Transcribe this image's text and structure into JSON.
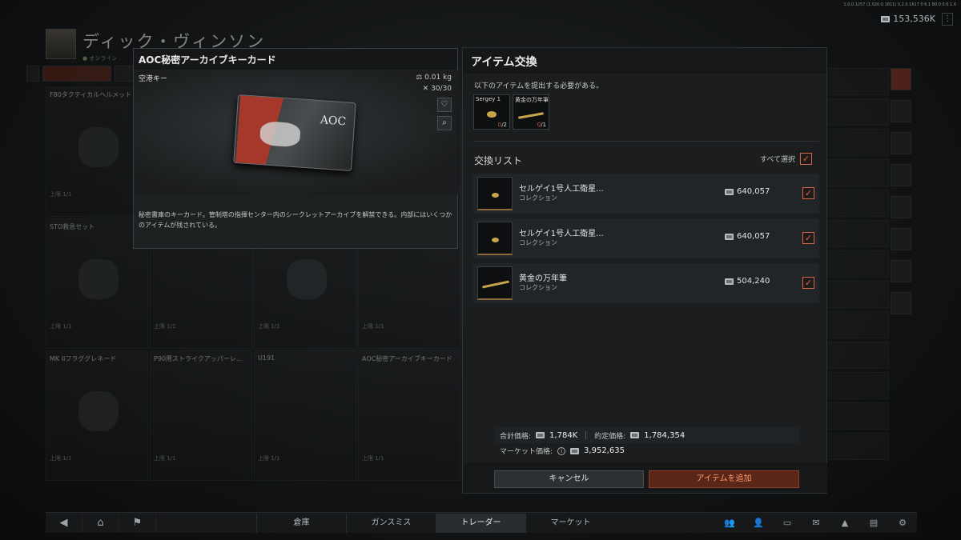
{
  "version": "1.0.0.1257 (1.020.0.1811) 0.2.0.1617 0 6.1 80.0 0.0 1.0",
  "currency": {
    "amount": "153,536K"
  },
  "player": {
    "name": "ディック・ヴィンソン",
    "status": "● オンライン"
  },
  "background_items": [
    {
      "name": "F80タクティカルヘルメット",
      "limit": "上限 1/1"
    },
    {
      "name": "",
      "limit": ""
    },
    {
      "name": "",
      "limit": ""
    },
    {
      "name": "",
      "limit": ""
    },
    {
      "name": "STO救急セット",
      "limit": "上限 1/1"
    },
    {
      "name": "",
      "limit": "上限 1/1"
    },
    {
      "name": "",
      "limit": "上限 1/1"
    },
    {
      "name": "",
      "limit": "上限 1/1"
    },
    {
      "name": "MK IIフラググレネード",
      "limit": "上限 1/1"
    },
    {
      "name": "P90用ストライクアッパーレ...",
      "limit": "上限 1/1"
    },
    {
      "name": "U191",
      "limit": "上限 1/1"
    },
    {
      "name": "AOC秘密アーカイブキーカード",
      "limit": "上限 1/1"
    }
  ],
  "detail": {
    "title": "AOC秘密アーカイブキーカード",
    "subtype": "空港キー",
    "weight": "0.01 kg",
    "durability": "30/30",
    "card_logo": "AOC",
    "description": "秘密書庫のキーカード。管制塔の指揮センター内のシークレットアーカイブを解禁できる。内部にはいくつかのアイテムが残されている。"
  },
  "dialog": {
    "title": "アイテム交換",
    "requirement_text": "以下のアイテムを提出する必要がある。",
    "required_items": [
      {
        "name": "Sergey 1",
        "have": "0",
        "need": "/2"
      },
      {
        "name": "黄金の万年筆",
        "have": "0",
        "need": "/1"
      }
    ],
    "list_title": "交換リスト",
    "select_all": "すべて選択",
    "check_mark": "✓",
    "items": [
      {
        "name": "セルゲイ1号人工衛星...",
        "category": "コレクション",
        "price": "640,057"
      },
      {
        "name": "セルゲイ1号人工衛星...",
        "category": "コレクション",
        "price": "640,057"
      },
      {
        "name": "黄金の万年筆",
        "category": "コレクション",
        "price": "504,240"
      }
    ],
    "total_label": "合計価格:",
    "total_value": "1,784K",
    "contract_label": "約定価格:",
    "contract_value": "1,784,354",
    "market_label": "マーケット価格:",
    "market_value": "3,952,635",
    "cancel_label": "キャンセル",
    "add_label": "アイテムを追加"
  },
  "bottom_nav": {
    "tabs": [
      "倉庫",
      "ガンスミス",
      "トレーダー",
      "マーケット"
    ],
    "active_tab": "トレーダー"
  },
  "colors": {
    "accent": "#d0664e",
    "add_button": "#5a2618"
  }
}
